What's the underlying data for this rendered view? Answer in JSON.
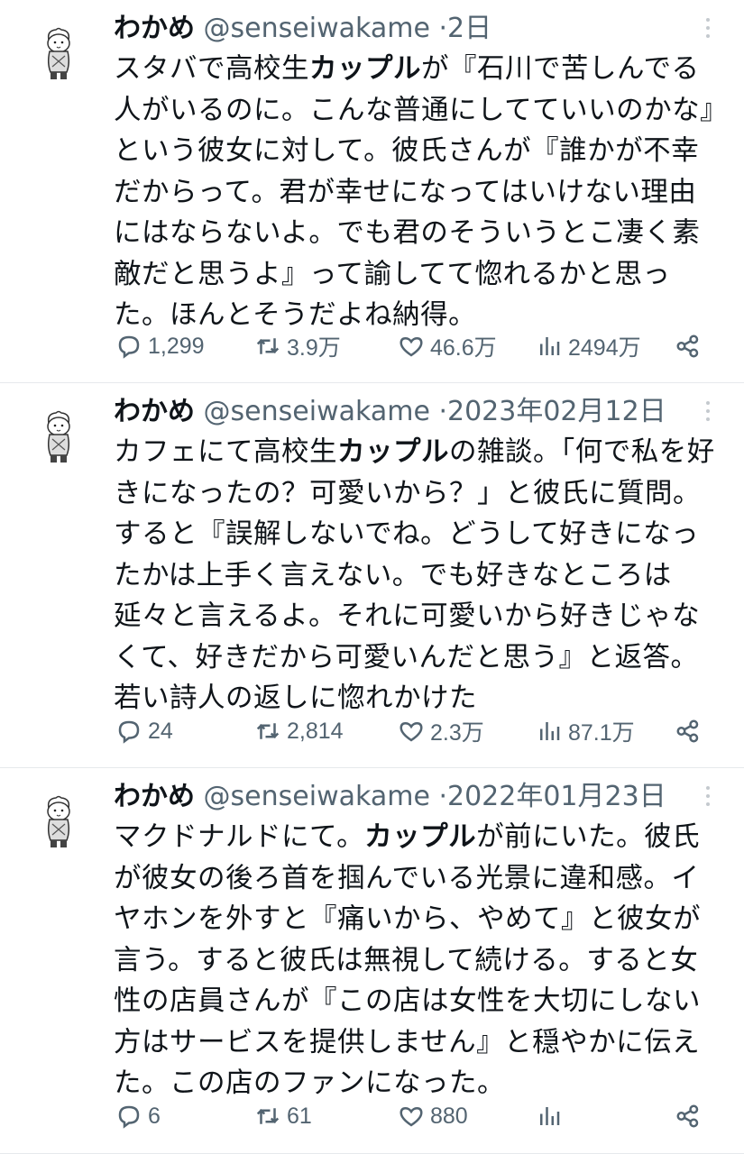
{
  "tweets": [
    {
      "name": "わかめ",
      "handle": "@senseiwakame",
      "separator": "·",
      "time": "2日",
      "text_before": "スタバで高校生",
      "text_bold": "カップル",
      "text_after": "が『石川で苦しんでる人がいるのに。こんな普通にしてていいのかな』という彼女に対して。彼氏さんが『誰かが不幸だからって。君が幸せになってはいけない理由にはならないよ。でも君のそういうとこ凄く素敵だと思うよ』って諭してて惚れるかと思った。ほんとそうだよね納得。",
      "replies": "1,299",
      "retweets": "3.9万",
      "likes": "46.6万",
      "views": "2494万"
    },
    {
      "name": "わかめ",
      "handle": "@senseiwakame",
      "separator": "·",
      "time": "2023年02月12日",
      "text_before": "カフェにて高校生",
      "text_bold": "カップル",
      "text_after": "の雑談。「何で私を好きになったの？可愛いから？」と彼氏に質問。すると『誤解しないでね。どうして好きになったかは上手く言えない。でも好きなところは延々と言えるよ。それに可愛いから好きじゃなくて、好きだから可愛いんだと思う』と返答。若い詩人の返しに惚れかけた",
      "replies": "24",
      "retweets": "2,814",
      "likes": "2.3万",
      "views": "87.1万"
    },
    {
      "name": "わかめ",
      "handle": "@senseiwakame",
      "separator": "·",
      "time": "2022年01月23日",
      "text_before": "マクドナルドにて。",
      "text_bold": "カップル",
      "text_after": "が前にいた。彼氏が彼女の後ろ首を掴んでいる光景に違和感。イヤホンを外すと『痛いから、やめて』と彼女が言う。すると彼氏は無視して続ける。すると女性の店員さんが『この店は女性を大切にしない方はサービスを提供しません』と穏やかに伝えた。この店のファンになった。",
      "replies": "6",
      "retweets": "61",
      "likes": "880",
      "views": ""
    }
  ],
  "icons": {
    "reply": "reply-icon",
    "retweet": "retweet-icon",
    "like": "like-icon",
    "views": "views-icon",
    "share": "share-icon",
    "more": "more-icon",
    "avatar": "avatar"
  },
  "colors": {
    "text": "#0f1419",
    "secondary": "#536471",
    "divider": "#e6e9ec"
  }
}
